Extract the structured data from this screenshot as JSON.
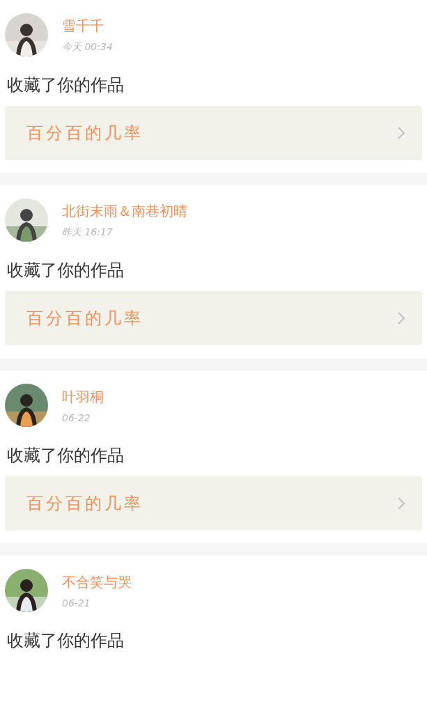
{
  "notifications": [
    {
      "user": "雪千千",
      "time": "今天 00:34",
      "action": "收藏了你的作品",
      "work": "百分百的几率"
    },
    {
      "user": "北街末雨＆南巷初晴",
      "time": "昨天 16:17",
      "action": "收藏了你的作品",
      "work": "百分百的几率"
    },
    {
      "user": "叶羽桐",
      "time": "06-22",
      "action": "收藏了你的作品",
      "work": "百分百的几率"
    },
    {
      "user": "不合笑与哭",
      "time": "06-21",
      "action": "收藏了你的作品"
    }
  ]
}
